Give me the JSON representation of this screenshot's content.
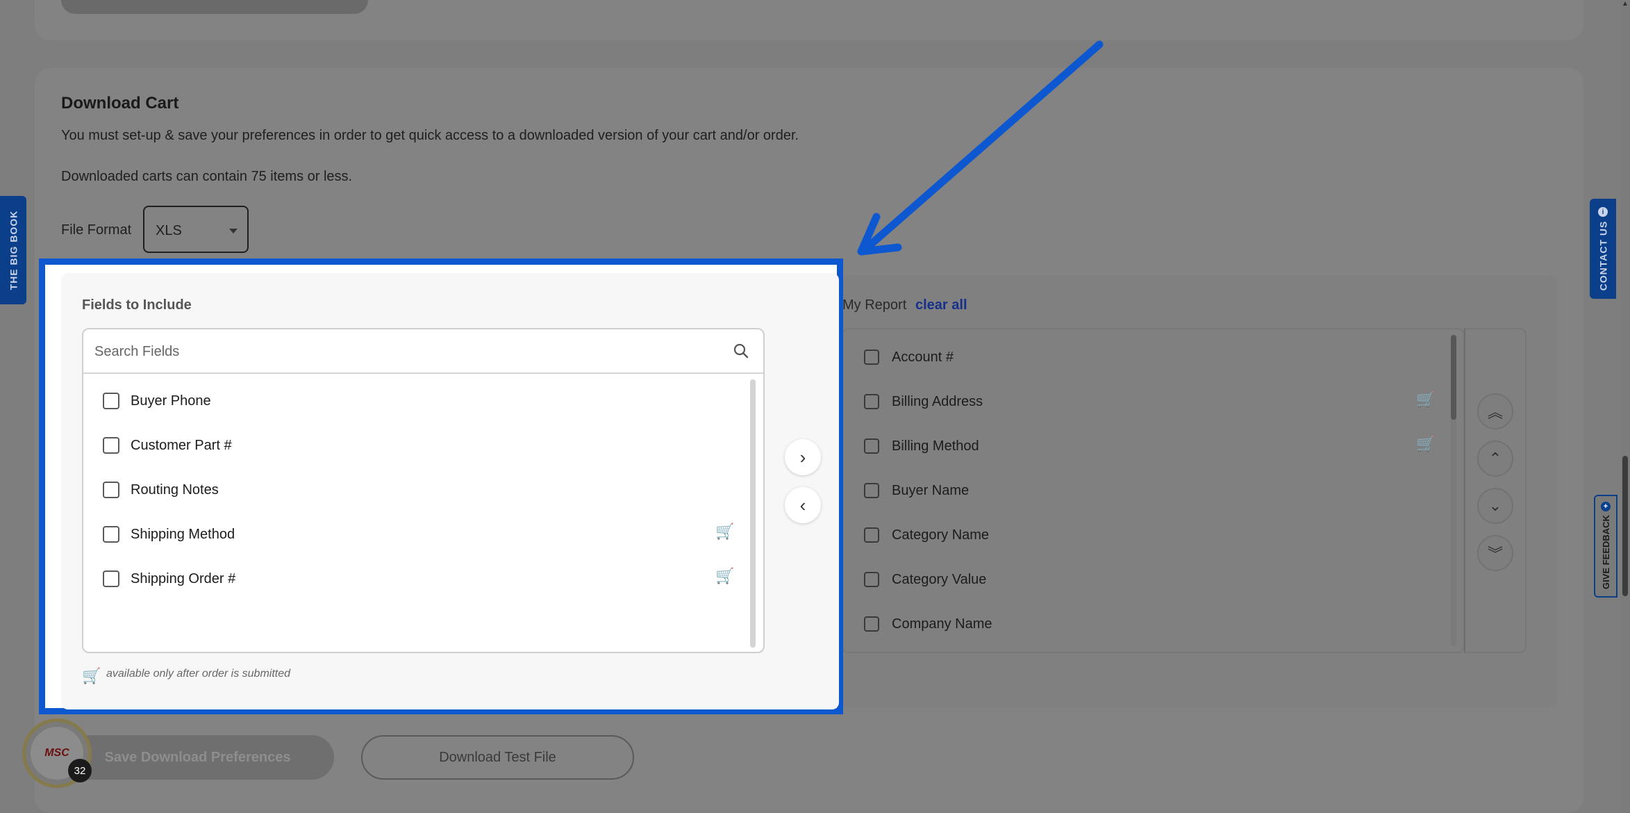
{
  "section": {
    "title": "Download Cart",
    "description": "You must set-up & save your preferences in order to get quick access to a downloaded version of your cart and/or order.",
    "limit_note": "Downloaded carts can contain 75 items or less."
  },
  "file_format": {
    "label": "File Format",
    "selected": "XLS"
  },
  "fields_panel": {
    "title": "Fields to Include",
    "search_placeholder": "Search Fields",
    "items": [
      {
        "label": "Buyer Phone",
        "checked": false,
        "order_only": false
      },
      {
        "label": "Customer Part #",
        "checked": false,
        "order_only": false
      },
      {
        "label": "Routing Notes",
        "checked": false,
        "order_only": false
      },
      {
        "label": "Shipping Method",
        "checked": false,
        "order_only": true
      },
      {
        "label": "Shipping Order #",
        "checked": false,
        "order_only": true
      }
    ],
    "legend": "available only after order is submitted"
  },
  "report_panel": {
    "title": "My Report",
    "clear_all": "clear all",
    "items": [
      {
        "label": "Account #",
        "checked": false,
        "order_only": false
      },
      {
        "label": "Billing Address",
        "checked": false,
        "order_only": true
      },
      {
        "label": "Billing Method",
        "checked": false,
        "order_only": true
      },
      {
        "label": "Buyer Name",
        "checked": false,
        "order_only": false
      },
      {
        "label": "Category Name",
        "checked": false,
        "order_only": false
      },
      {
        "label": "Category Value",
        "checked": false,
        "order_only": false
      },
      {
        "label": "Company Name",
        "checked": false,
        "order_only": false
      }
    ]
  },
  "transfer_buttons": {
    "add_icon": "chevron-right-icon",
    "remove_icon": "chevron-left-icon"
  },
  "order_buttons": [
    "double-chevron-up-icon",
    "chevron-up-icon",
    "chevron-down-icon",
    "double-chevron-down-icon"
  ],
  "actions": {
    "save": "Save Download Preferences",
    "test_file": "Download Test File"
  },
  "side_tabs": {
    "big_book": "THE BIG BOOK",
    "contact": "CONTACT US",
    "feedback": "GIVE FEEDBACK"
  },
  "logo": {
    "text": "MSC",
    "badge": "32"
  },
  "colors": {
    "highlight": "#0d57d0",
    "tab_blue": "#0b3f8a",
    "link": "#17318a"
  }
}
